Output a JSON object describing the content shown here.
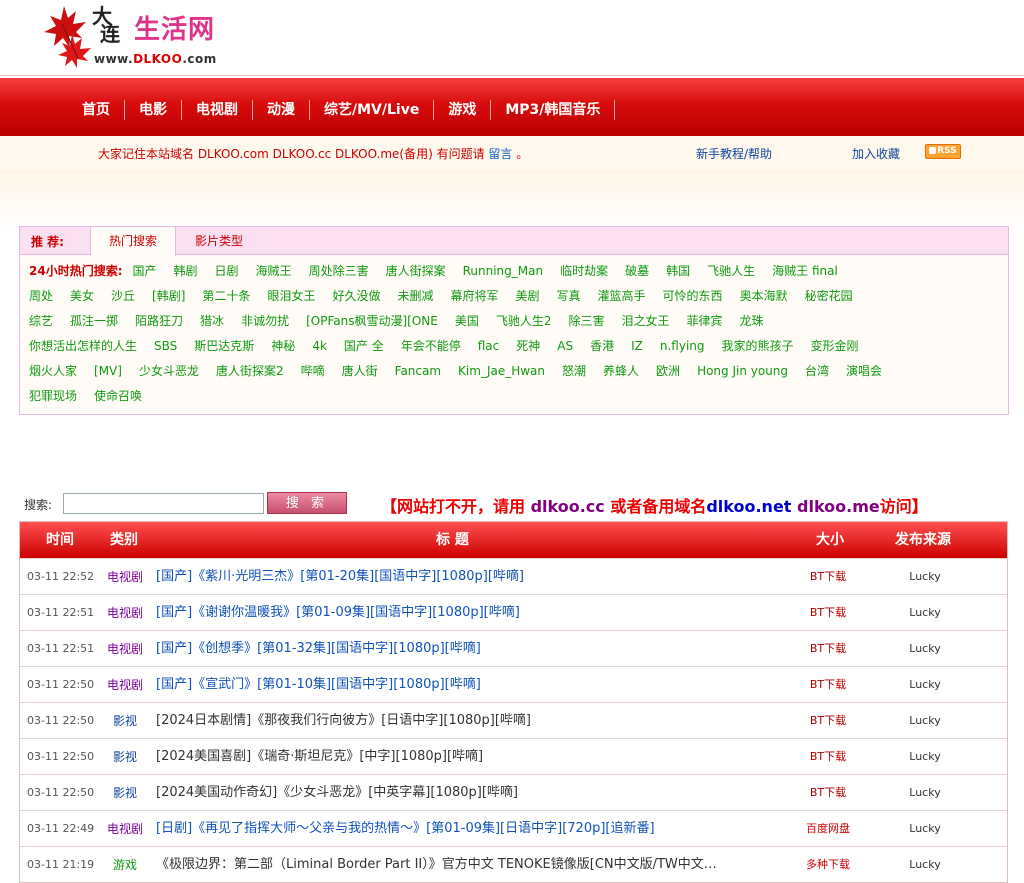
{
  "logo": {
    "char1": "大",
    "char2": "连",
    "title": "生活网",
    "url_pre": "www.",
    "url_brand": "DLKOO",
    "url_post": ".com"
  },
  "nav": [
    "首页",
    "电影",
    "电视剧",
    "动漫",
    "综艺/MV/Live",
    "游戏",
    "MP3/韩国音乐"
  ],
  "notice": {
    "text": "大家记住本站域名 DLKOO.com DLKOO.cc DLKOO.me(备用) 有问题请",
    "link": "留言",
    "end": " 。",
    "help": "新手教程/帮助",
    "fav": "加入收藏",
    "rss": "RSS"
  },
  "rec": {
    "label": "推  荐:",
    "tabs": [
      "热门搜索",
      "影片类型"
    ]
  },
  "hot": {
    "heading": "24小时热门搜索:",
    "rows": [
      [
        "国产",
        "韩剧",
        "日剧",
        "海贼王",
        "周处除三害",
        "唐人街探案",
        "Running_Man",
        "临时劫案",
        "破墓",
        "韩国",
        "飞驰人生",
        "海贼王 final"
      ],
      [
        "周处",
        "美女",
        "沙丘",
        "[韩剧]",
        "第二十条",
        "眼泪女王",
        "好久没做",
        "未删减",
        "幕府将军",
        "美剧",
        "写真",
        "灌篮高手",
        "可怜的东西",
        "奥本海默",
        "秘密花园"
      ],
      [
        "综艺",
        "孤注一掷",
        "陌路狂刀",
        "猎冰",
        "非诚勿扰",
        "[OPFans枫雪动漫][ONE",
        "美国",
        "飞驰人生2",
        "除三害",
        "泪之女王",
        "菲律宾",
        "龙珠"
      ],
      [
        "你想活出怎样的人生",
        "SBS",
        "斯巴达克斯",
        "神秘",
        "4k",
        "国产 全",
        "年会不能停",
        "flac",
        "死神",
        "AS",
        "香港",
        "IZ",
        "n.flying",
        "我家的熊孩子",
        "变形金刚"
      ],
      [
        "烟火人家",
        "[MV]",
        "少女斗恶龙",
        "唐人街探案2",
        "哔嘀",
        "唐人街",
        "Fancam",
        "Kim_Jae_Hwan",
        "怒潮",
        "养蜂人",
        "欧洲",
        "Hong Jin young",
        "台湾",
        "演唱会"
      ],
      [
        "犯罪现场",
        "使命召唤"
      ]
    ]
  },
  "search": {
    "label": "搜索:",
    "value": "",
    "button": "搜 索",
    "alert_a": "【网站打不开，请用 ",
    "alert_b": "dlkoo.cc",
    "alert_c": " 或者备用域名",
    "alert_d": "dlkoo.net",
    "alert_e": " ",
    "alert_f": "dlkoo.me",
    "alert_g": "访问】"
  },
  "table": {
    "headers": [
      "时间",
      "类别",
      "标  题",
      "大小",
      "发布来源"
    ],
    "rows": [
      {
        "time": "03-11 22:52",
        "cat": "电视剧",
        "title": "[国产]《紫川·光明三杰》[第01-20集][国语中字][1080p][哔嘀]",
        "size": "BT下载",
        "src": "Lucky",
        "kind": "tv"
      },
      {
        "time": "03-11 22:51",
        "cat": "电视剧",
        "title": "[国产]《谢谢你温暖我》[第01-09集][国语中字][1080p][哔嘀]",
        "size": "BT下载",
        "src": "Lucky",
        "kind": "tv"
      },
      {
        "time": "03-11 22:51",
        "cat": "电视剧",
        "title": "[国产]《创想季》[第01-32集][国语中字][1080p][哔嘀]",
        "size": "BT下载",
        "src": "Lucky",
        "kind": "tv"
      },
      {
        "time": "03-11 22:50",
        "cat": "电视剧",
        "title": "[国产]《宣武门》[第01-10集][国语中字][1080p][哔嘀]",
        "size": "BT下载",
        "src": "Lucky",
        "kind": "tv"
      },
      {
        "time": "03-11 22:50",
        "cat": "影视",
        "title": "[2024日本剧情]《那夜我们行向彼方》[日语中字][1080p][哔嘀]",
        "size": "BT下载",
        "src": "Lucky",
        "kind": "mv"
      },
      {
        "time": "03-11 22:50",
        "cat": "影视",
        "title": "[2024美国喜剧]《瑞奇·斯坦尼克》[中字][1080p][哔嘀]",
        "size": "BT下载",
        "src": "Lucky",
        "kind": "mv"
      },
      {
        "time": "03-11 22:50",
        "cat": "影视",
        "title": "[2024美国动作奇幻]《少女斗恶龙》[中英字幕][1080p][哔嘀]",
        "size": "BT下载",
        "src": "Lucky",
        "kind": "mv"
      },
      {
        "time": "03-11 22:49",
        "cat": "电视剧",
        "title": "[日剧]《再见了指挥大师～父亲与我的热情～》[第01-09集][日语中字][720p][追新番]",
        "size": "百度网盘",
        "src": "Lucky",
        "kind": "tv"
      },
      {
        "time": "03-11 21:19",
        "cat": "游戏",
        "title": "《极限边界：第二部（Liminal Border Part II）》官方中文 TENOKE镜像版[CN中文版/TW中文…",
        "size": "多种下载",
        "src": "Lucky",
        "kind": "game"
      }
    ]
  },
  "colors": {
    "tv_cat": "#8000a0",
    "tv_title": "#1052b8",
    "mv_cat": "#1046a0",
    "mv_title": "#333333",
    "game_cat": "#119911",
    "game_title": "#333333",
    "size_bt": "#b00000",
    "size_other": "#cc0000"
  }
}
